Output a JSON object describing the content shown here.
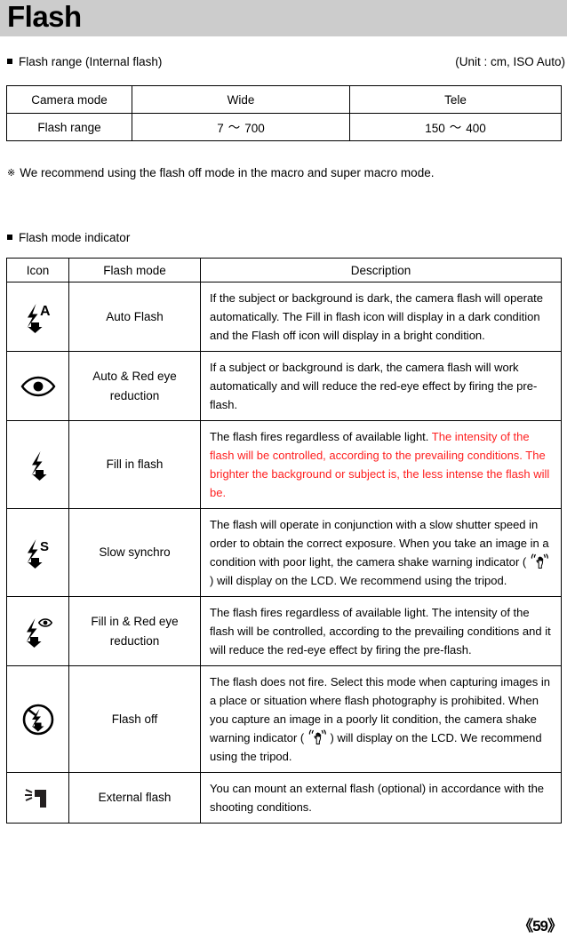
{
  "header": {
    "title": "Flash"
  },
  "range_section": {
    "heading": "Flash range (Internal flash)",
    "unit_note": "(Unit : cm, ISO Auto)",
    "table": {
      "columns": [
        "Camera mode",
        "Wide",
        "Tele"
      ],
      "rows": [
        {
          "label": "Flash range",
          "wide_min": "7",
          "wide_sep": "〜",
          "wide_max": "700",
          "tele_min": "150",
          "tele_sep": "〜",
          "tele_max": "400"
        }
      ]
    }
  },
  "recommend_note": {
    "glyph": "※",
    "text": "We recommend using the flash off mode in the macro and super macro mode."
  },
  "mode_section": {
    "heading": "Flash mode indicator",
    "columns": [
      "Icon",
      "Flash mode",
      "Description"
    ],
    "rows": [
      {
        "icon": "flash-auto-icon",
        "mode": "Auto Flash",
        "desc_black_1": "If the subject or background is dark, the camera flash will operate automatically. The Fill in flash icon will display in a dark condition and the Flash off icon will display in a bright condition.",
        "desc_red": "",
        "desc_black_2": ""
      },
      {
        "icon": "red-eye-icon",
        "mode": "Auto & Red eye reduction",
        "mode_line1": "Auto & Red eye",
        "mode_line2": "reduction",
        "desc_black_1": "If a subject or background is dark, the camera flash will work automatically and will reduce the red-eye effect by firing the pre-flash.",
        "desc_red": "",
        "desc_black_2": ""
      },
      {
        "icon": "fill-in-flash-icon",
        "mode": "Fill in flash",
        "desc_black_1": "The flash fires regardless of available light. ",
        "desc_red": "The intensity of the flash will be controlled, according to the prevailing conditions. The brighter the background or subject is, the less intense the flash will be.",
        "desc_black_2": ""
      },
      {
        "icon": "slow-synchro-icon",
        "mode": "Slow synchro",
        "desc_black_1": "The flash will operate in conjunction with a slow shutter speed in order to obtain the correct exposure. When you take an image in a condition with poor light, the camera shake warning indicator ( ",
        "desc_red": "",
        "desc_black_2": " ) will display on the LCD. We recommend using the tripod.",
        "has_shake_icon": true
      },
      {
        "icon": "fill-in-red-eye-icon",
        "mode": "Fill in & Red eye reduction",
        "mode_line1": "Fill in & Red eye",
        "mode_line2": "reduction",
        "desc_black_1": "The flash fires regardless of available light. The intensity of the flash will be controlled, according to the prevailing conditions and it will reduce the red-eye effect by firing the pre-flash.",
        "desc_red": "",
        "desc_black_2": ""
      },
      {
        "icon": "flash-off-icon",
        "mode": "Flash off",
        "desc_black_1": "The flash does not fire. Select this mode when capturing images in a place or situation where flash photography is prohibited. When you capture an image in a poorly lit condition, the camera shake warning indicator ( ",
        "desc_red": "",
        "desc_black_2": " ) will display on the LCD. We recommend using the tripod.",
        "has_shake_icon": true
      },
      {
        "icon": "external-flash-icon",
        "mode": "External flash",
        "desc_black_1": "You can mount an external flash (optional) in accordance with the shooting conditions.",
        "desc_red": "",
        "desc_black_2": ""
      }
    ]
  },
  "footer": {
    "page_number": "《59》"
  },
  "colors": {
    "title_band": "#cccccc",
    "highlight_red": "#ff1f1f",
    "text": "#000000"
  }
}
